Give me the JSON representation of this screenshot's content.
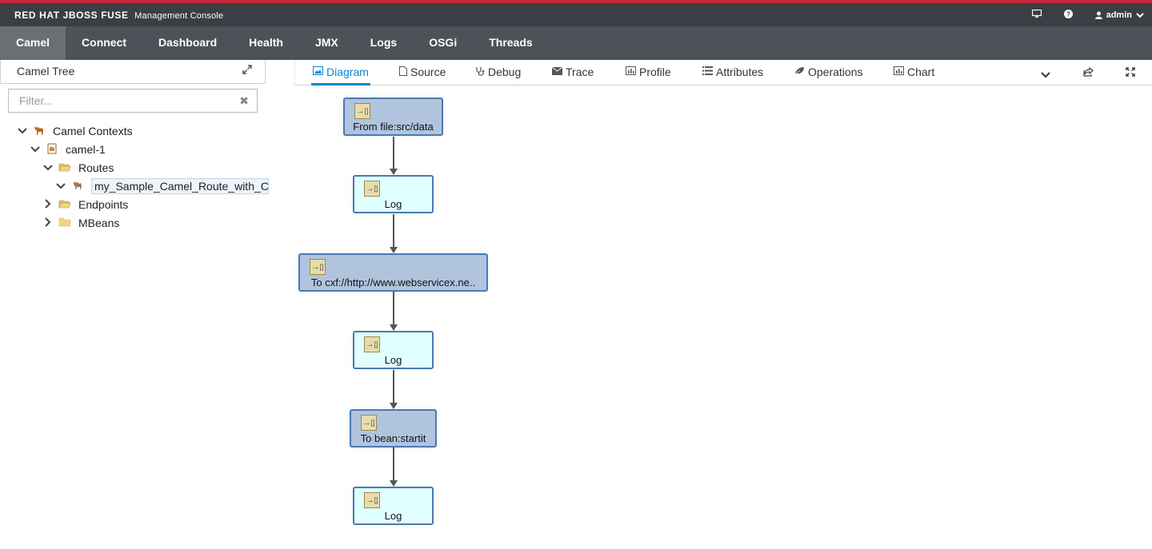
{
  "header": {
    "brand": "RED HAT JBOSS FUSE",
    "subtitle": "Management Console",
    "user": "admin"
  },
  "nav": [
    "Camel",
    "Connect",
    "Dashboard",
    "Health",
    "JMX",
    "Logs",
    "OSGi",
    "Threads"
  ],
  "tree": {
    "title": "Camel Tree",
    "filter_placeholder": "Filter...",
    "items": {
      "contexts": "Camel Contexts",
      "camel1": "camel-1",
      "routes": "Routes",
      "route": "my_Sample_Camel_Route_with_CXF",
      "endpoints": "Endpoints",
      "mbeans": "MBeans"
    }
  },
  "tabs": [
    "Diagram",
    "Source",
    "Debug",
    "Trace",
    "Profile",
    "Attributes",
    "Operations",
    "Chart"
  ],
  "diagram": {
    "nodes": [
      "From file:src/data",
      "Log",
      "To cxf://http://www.webservicex.ne..",
      "Log",
      "To bean:startit",
      "Log"
    ]
  }
}
